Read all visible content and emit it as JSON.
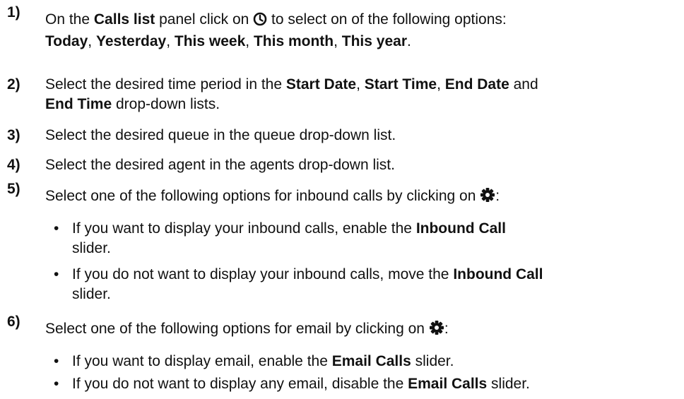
{
  "steps": [
    {
      "num": "1)",
      "t1": "On the ",
      "b1": "Calls list",
      "t2": " panel click on ",
      "icon": "clock-icon",
      "t3": " to select on of the following options:",
      "o1": "Today",
      "s1": ", ",
      "o2": "Yesterday",
      "s2": ", ",
      "o3": "This week",
      "s3": ", ",
      "o4": "This month",
      "s4": ", ",
      "o5": "This year",
      "end": "."
    },
    {
      "num": "2)",
      "t1": "Select the desired time period in the ",
      "b1": "Start Date",
      "s1": ", ",
      "b2": "Start Time",
      "s2": ", ",
      "b3": "End Date",
      "t2": " and",
      "b4": "End Time",
      "t3": " drop-down lists."
    },
    {
      "num": "3)",
      "text": "Select the desired queue in the queue drop-down list."
    },
    {
      "num": "4)",
      "text": "Select the desired agent in the agents drop-down list."
    },
    {
      "num": "5)",
      "t1": "Select one of the following options for inbound calls by clicking on ",
      "icon": "gear-icon",
      "t2": ":",
      "bullets": [
        {
          "dot": "•",
          "t1": "If you want to display your inbound calls, enable the ",
          "b1": "Inbound Call",
          "t2": "slider."
        },
        {
          "dot": "•",
          "t1": "If you do not want to display your inbound calls, move the ",
          "b1": "Inbound Call",
          "t2": "slider."
        }
      ]
    },
    {
      "num": "6)",
      "t1": "Select one of the following options for email by clicking on ",
      "icon": "gear-icon",
      "t2": ":",
      "bullets": [
        {
          "dot": "•",
          "t1": "If you want to display email, enable the ",
          "b1": "Email Calls",
          "t2": " slider."
        },
        {
          "dot": "•",
          "t1": "If you do not want to display any email, disable the ",
          "b1": "Email Calls",
          "t2": " slider."
        }
      ]
    }
  ]
}
